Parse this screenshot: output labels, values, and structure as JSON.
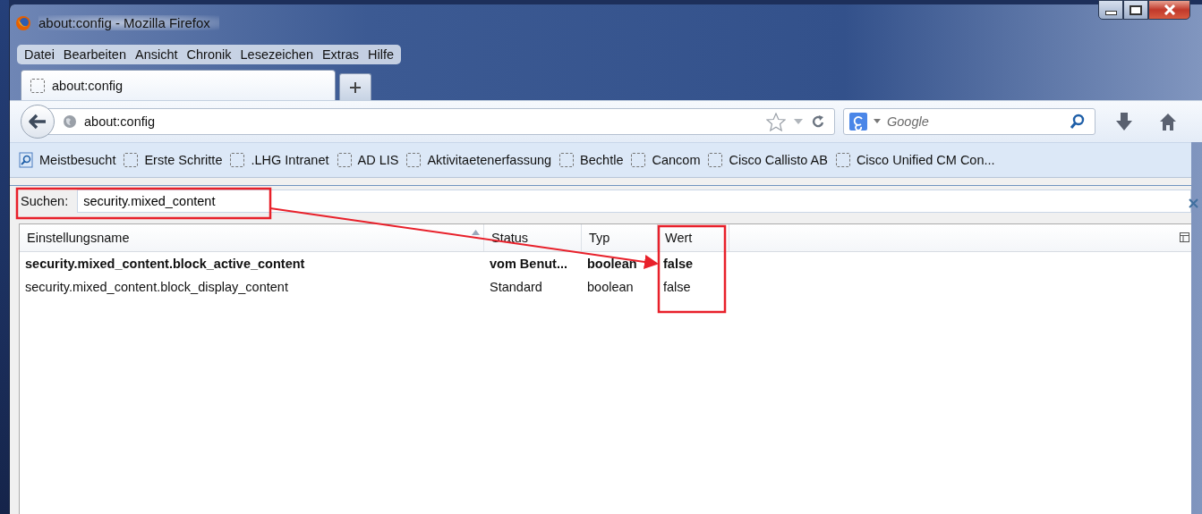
{
  "window": {
    "title": "about:config - Mozilla Firefox"
  },
  "menu": [
    {
      "label": "Datei"
    },
    {
      "label": "Bearbeiten"
    },
    {
      "label": "Ansicht"
    },
    {
      "label": "Chronik"
    },
    {
      "label": "Lesezeichen"
    },
    {
      "label": "Extras"
    },
    {
      "label": "Hilfe"
    }
  ],
  "tabs": [
    {
      "label": "about:config",
      "selected": true
    }
  ],
  "address": {
    "value": "about:config"
  },
  "search": {
    "placeholder": "Google"
  },
  "bookmarks": [
    {
      "label": "Meistbesucht",
      "kind": "smart"
    },
    {
      "label": "Erste Schritte",
      "kind": "page"
    },
    {
      "label": ".LHG Intranet",
      "kind": "page"
    },
    {
      "label": "AD LIS",
      "kind": "page"
    },
    {
      "label": "Aktivitaetenerfassung",
      "kind": "page"
    },
    {
      "label": "Bechtle",
      "kind": "page"
    },
    {
      "label": "Cancom",
      "kind": "page"
    },
    {
      "label": "Cisco Callisto AB",
      "kind": "page"
    },
    {
      "label": "Cisco Unified CM Con...",
      "kind": "page"
    }
  ],
  "filter": {
    "label": "Suchen:",
    "value": "security.mixed_content"
  },
  "table": {
    "columns": [
      {
        "label": "Einstellungsname",
        "sorted": true
      },
      {
        "label": "Status",
        "sorted": false
      },
      {
        "label": "Typ",
        "sorted": false
      },
      {
        "label": "Wert",
        "sorted": false
      }
    ],
    "rows": [
      {
        "name": "security.mixed_content.block_active_content",
        "status": "vom Benut...",
        "type": "boolean",
        "value": "false",
        "modified": true
      },
      {
        "name": "security.mixed_content.block_display_content",
        "status": "Standard",
        "type": "boolean",
        "value": "false",
        "modified": false
      }
    ]
  }
}
